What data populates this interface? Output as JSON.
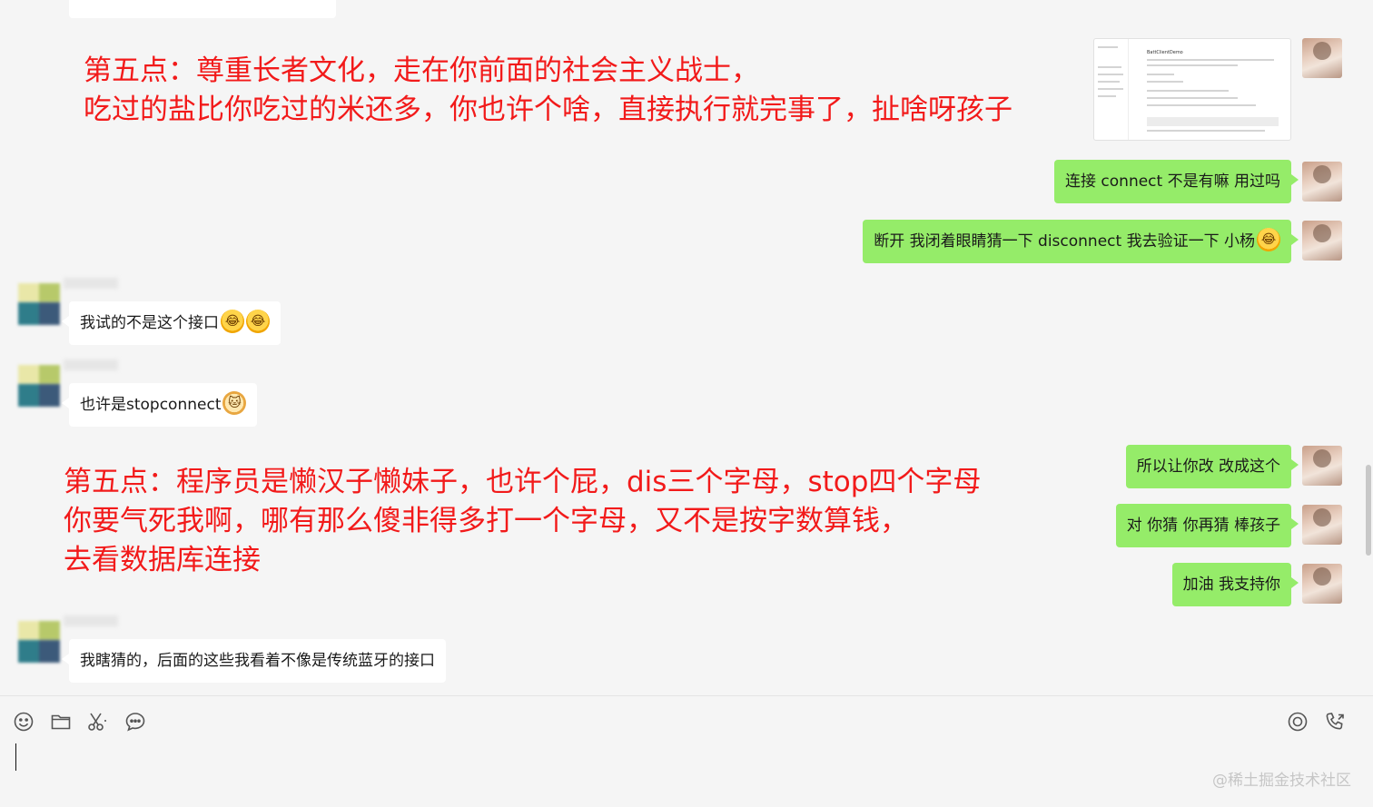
{
  "annotations": {
    "first": {
      "line1": "第五点：尊重长者文化，走在你前面的社会主义战士，",
      "line2": "吃过的盐比你吃过的米还多，你也许个啥，直接执行就完事了，扯啥呀孩子"
    },
    "second": {
      "line1": "第五点：程序员是懒汉子懒妹子，也许个屁，dis三个字母，stop四个字母",
      "line2": "你要气死我啊，哪有那么傻非得多打一个字母，又不是按字数算钱，",
      "line3": "去看数据库连接"
    }
  },
  "messages": {
    "m1": "连接 connect 不是有嘛 用过吗",
    "m2": "断开 我闭着眼睛猜一下  disconnect 我去验证一下 小杨",
    "m3": "我试的不是这个接口",
    "m4": "也许是stopconnect",
    "m5": "所以让你改 改成这个",
    "m6": "对 你猜 你再猜 棒孩子",
    "m7": "加油 我支持你",
    "m8": "我瞎猜的，后面的这些我看着不像是传统蓝牙的接口"
  },
  "thumbnail": {
    "title": "BattClientDemo"
  },
  "toolbar": {
    "icons": [
      "emoji-icon",
      "folder-icon",
      "scissors-icon",
      "chat-bubble-icon",
      "live-icon",
      "phone-icon"
    ]
  },
  "watermark": "@稀土掘金技术社区",
  "colors": {
    "annotation": "#f21a1a",
    "outgoing_bubble": "#95ec69",
    "incoming_bubble": "#ffffff",
    "background": "#f5f5f5"
  }
}
